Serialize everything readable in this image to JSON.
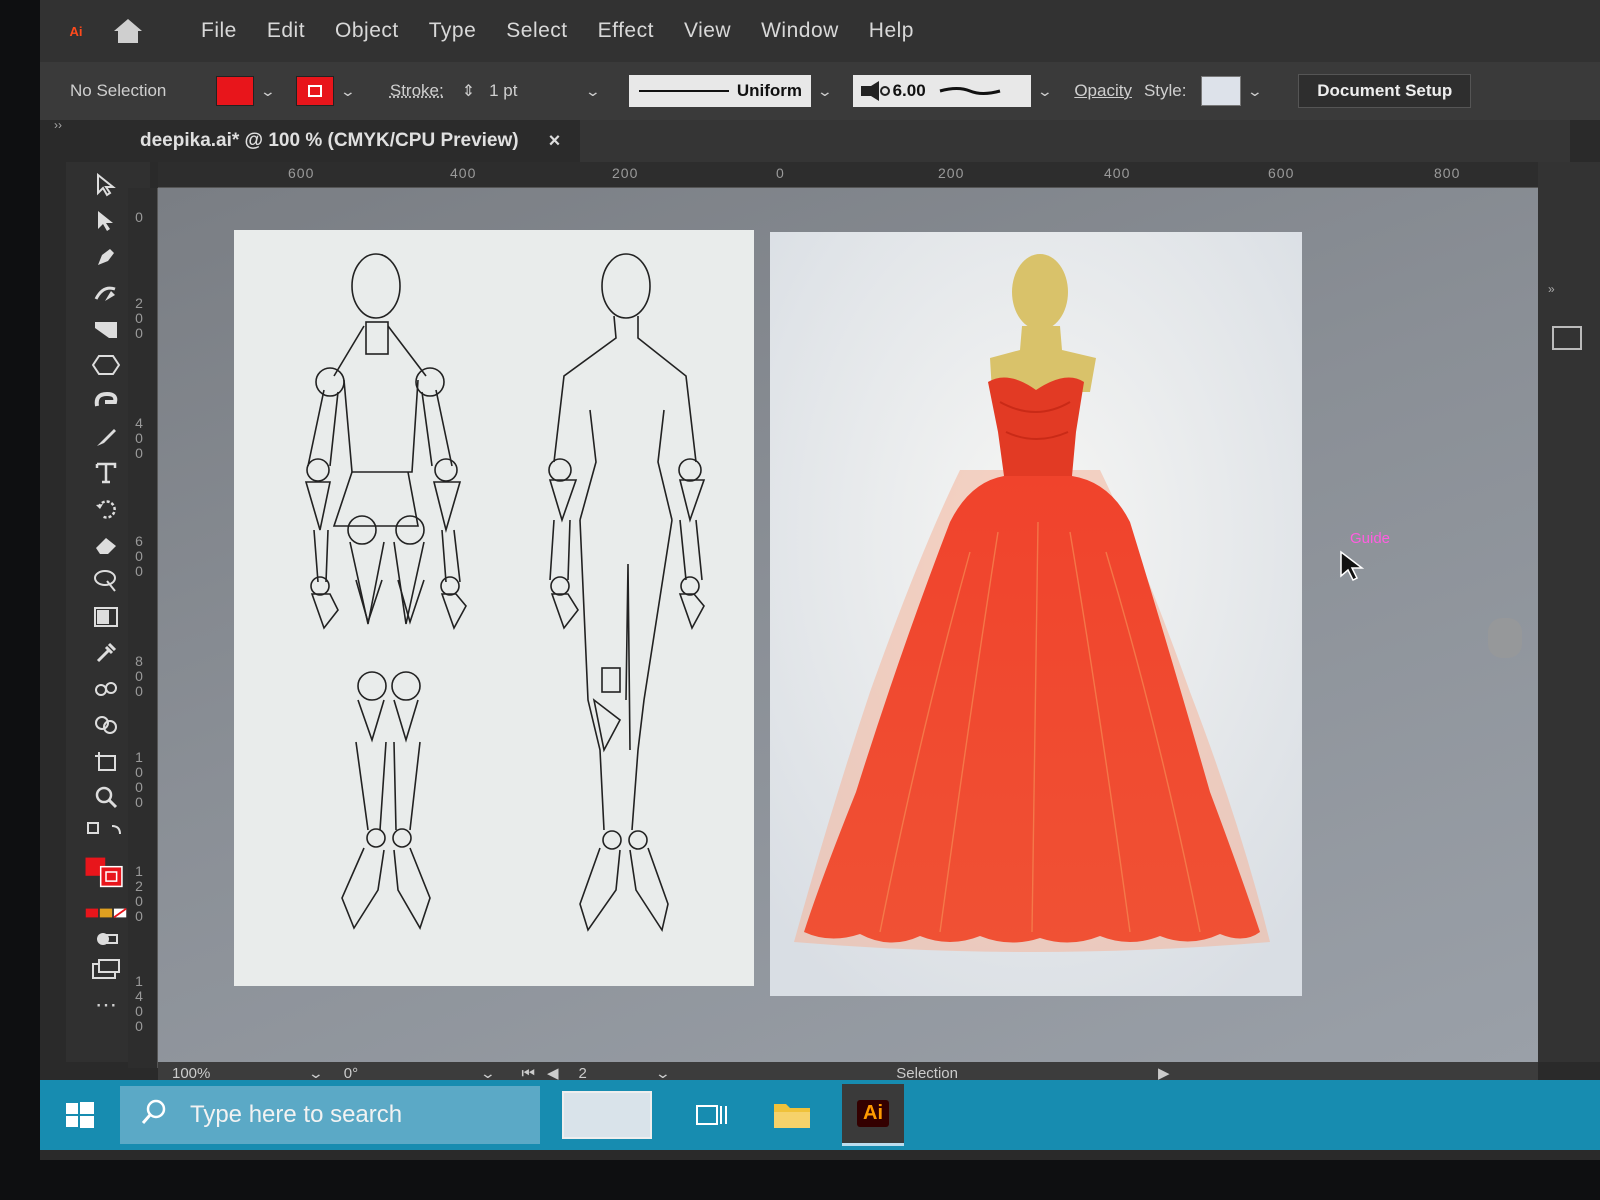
{
  "app": {
    "logo": "Ai",
    "menu": [
      "File",
      "Edit",
      "Object",
      "Type",
      "Select",
      "Effect",
      "View",
      "Window",
      "Help"
    ]
  },
  "control_bar": {
    "selection_status": "No Selection",
    "stroke_label": "Stroke:",
    "stroke_weight": "1 pt",
    "profile": "Uniform",
    "brush_size": "6.00",
    "opacity_label": "Opacity",
    "style_label": "Style:",
    "document_setup": "Document Setup",
    "fill_color": "#e8151b",
    "stroke_color": "#e8151b"
  },
  "document": {
    "tab_title": "deepika.ai* @ 100 % (CMYK/CPU Preview)",
    "close_glyph": "×"
  },
  "rulers": {
    "top": [
      "600",
      "400",
      "200",
      "0",
      "200",
      "400",
      "600",
      "800"
    ],
    "left": [
      "0",
      "200",
      "400",
      "600",
      "800",
      "1000",
      "1200",
      "1400"
    ]
  },
  "canvas": {
    "guide_label": "Guide",
    "dress_color": "#f0432c",
    "mannequin_color": "#d9c26a"
  },
  "status_bar": {
    "zoom": "100%",
    "rotation": "0°",
    "artboard_number": "2",
    "tool": "Selection"
  },
  "taskbar": {
    "search_placeholder": "Type here to search",
    "pinned_app": "Ai"
  },
  "icons": [
    "home-icon",
    "selection-tool-icon",
    "direct-selection-icon",
    "pen-tool-icon",
    "curvature-icon",
    "rectangle-icon",
    "polygon-icon",
    "shaper-icon",
    "brush-icon",
    "type-tool-icon",
    "rotate-icon",
    "eraser-icon",
    "lasso-icon",
    "gradient-icon",
    "eyedropper-icon",
    "blend-icon",
    "shape-builder-icon",
    "artboard-tool-icon",
    "zoom-icon",
    "windows-start-icon",
    "search-icon",
    "task-view-icon",
    "file-explorer-icon"
  ]
}
